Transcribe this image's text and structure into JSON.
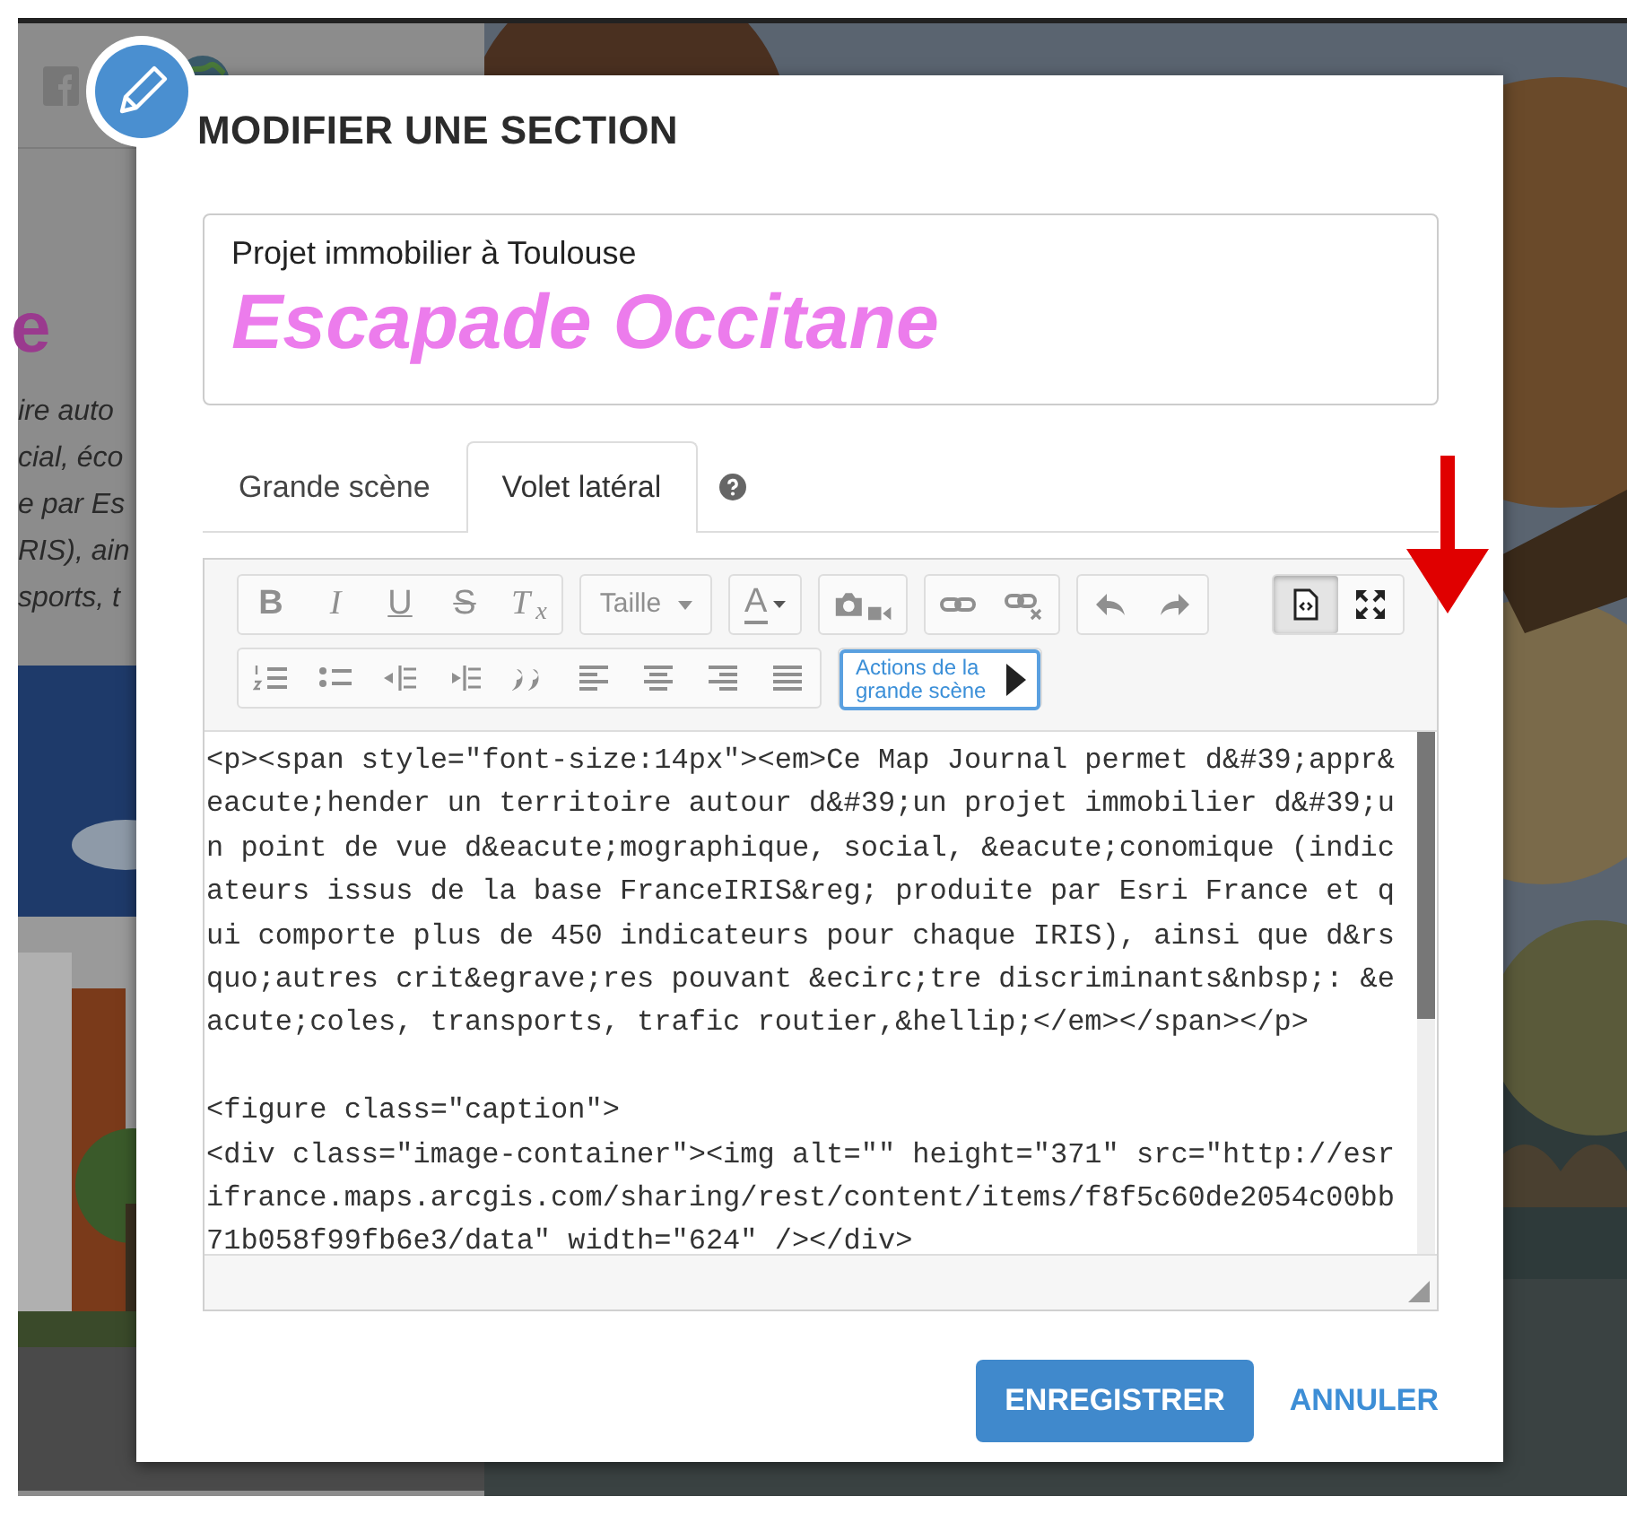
{
  "background": {
    "heading": "e",
    "lines": [
      "ire auto",
      "cial, éco",
      "e par Es",
      "RIS), ain",
      "sports, t"
    ]
  },
  "dialog": {
    "title": "MODIFIER UNE SECTION",
    "subtitle": "Projet immobilier à Toulouse",
    "headline": "Escapade Occitane"
  },
  "tabs": [
    {
      "label": "Grande scène",
      "selected": false
    },
    {
      "label": "Volet latéral",
      "selected": true
    }
  ],
  "toolbar": {
    "rows": [
      [
        {
          "items": [
            {
              "kind": "bold",
              "label": "B",
              "disabled": true
            },
            {
              "kind": "italic",
              "label": "I",
              "disabled": true
            },
            {
              "kind": "underline",
              "label": "U",
              "disabled": true
            },
            {
              "kind": "strike",
              "label": "S",
              "disabled": true
            },
            {
              "kind": "clear",
              "label": "T$_{x}$",
              "disabled": true
            }
          ]
        },
        {
          "items": [
            {
              "kind": "dropdown",
              "label": "Taille",
              "disabled": true
            }
          ]
        },
        {
          "items": [
            {
              "kind": "color",
              "label": "A",
              "disabled": true
            }
          ]
        },
        {
          "items": [
            {
              "kind": "media",
              "disabled": true
            }
          ]
        },
        {
          "items": [
            {
              "kind": "icon",
              "disabled": true
            },
            {
              "kind": "icon",
              "disabled": true
            }
          ]
        },
        {
          "items": [
            {
              "kind": "icon",
              "disabled": true
            },
            {
              "kind": "icon",
              "disabled": true
            }
          ]
        },
        {
          "items": [
            {
              "kind": "icon",
              "pressed": true
            },
            {
              "kind": "icon",
              "pressed": false
            }
          ]
        }
      ],
      [
        {
          "items": [
            {
              "kind": "icon",
              "disabled": true
            },
            {
              "kind": "icon",
              "disabled": true
            },
            {
              "kind": "icon",
              "disabled": true
            },
            {
              "kind": "icon",
              "disabled": true
            },
            {
              "kind": "icon",
              "disabled": true
            },
            {
              "kind": "icon",
              "disabled": true
            },
            {
              "kind": "icon",
              "disabled": true
            },
            {
              "kind": "icon",
              "disabled": true
            },
            {
              "kind": "icon",
              "disabled": true
            }
          ]
        },
        {
          "items": [
            {
              "kind": "action",
              "label": "Actions de la grande scène"
            }
          ]
        }
      ]
    ]
  },
  "code_blocks": [
    [
      "<p><span style=\"font-size:14px\"><em>Ce Map Journal permet d&#39;appr&",
      "eacute;hender un territoire autour d&#39;un projet immobilier d&#39;u",
      "n point de vue d&eacute;mographique, social, &eacute;conomique (indic",
      "ateurs issus de la base FranceIRIS&reg; produite par Esri France et q",
      "ui comporte plus de 450 indicateurs pour chaque IRIS), ainsi que d&rs",
      "quo;autres crit&egrave;res pouvant &ecirc;tre discriminants&nbsp;: &e",
      "acute;coles, transports, trafic routier,&hellip;</em></span></p>"
    ],
    [
      "<figure class=\"caption\">",
      "<div class=\"image-container\"><img alt=\"\" height=\"371\" src=\"http://esr",
      "ifrance.maps.arcgis.com/sharing/rest/content/items/f8f5c60de2054c00bb",
      "71b058f99fb6e3/data\" width=\"624\" /></div>"
    ]
  ],
  "buttons": [
    {
      "label": "ENREGISTRER",
      "kind": "primary"
    },
    {
      "label": "ANNULER",
      "kind": "link"
    }
  ]
}
